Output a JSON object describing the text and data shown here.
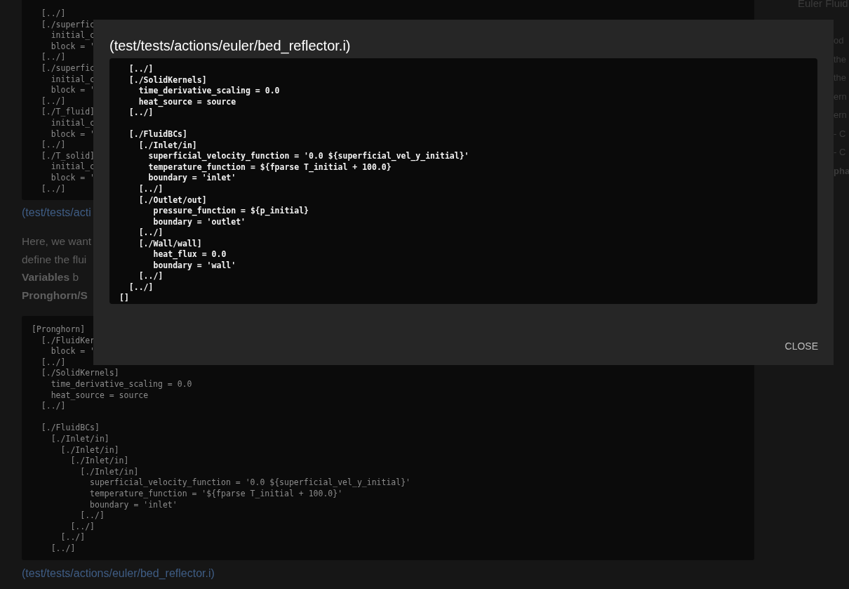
{
  "page": {
    "code_block_1": "  [../]\n  [./superfic\n    initial_c\n    block = '\n  [../]\n  [./superfic\n    initial_c\n    block = '\n  [../]\n  [./T_fluid]\n    initial_c\n    block = '\n  [../]\n  [./T_solid]\n    initial_c\n    block = '\n  [../]",
    "source_link_1": "(test/tests/acti",
    "paragraph": [
      "Here, we want",
      "define the flui",
      "**Variables** b",
      "**Pronghorn/S**"
    ],
    "code_block_2": "[Pronghorn]\n  [./FluidKer\n    block = '\n  [../]\n  [./SolidKernels]\n    time_derivative_scaling = 0.0\n    heat_source = source\n  [../]\n\n  [./FluidBCs]\n    [./Inlet/in]\n      [./Inlet/in]\n        [./Inlet/in]\n          [./Inlet/in]\n            superficial_velocity_function = '0.0 ${superficial_vel_y_initial}'\n            temperature_function = '${fparse T_initial + 100.0}'\n            boundary = 'inlet'\n          [../]\n        [../]\n      [../]\n    [../]",
    "source_link_2": "(test/tests/actions/euler/bed_reflector.i)"
  },
  "sidebar": {
    "lines": [
      "Euler Fluid",
      "od",
      "the",
      "the",
      "ern",
      "ern",
      "- C",
      "- C",
      "pha"
    ]
  },
  "modal": {
    "title": "(test/tests/actions/euler/bed_reflector.i)",
    "code": "  [../]\n  [./SolidKernels]\n    time_derivative_scaling = 0.0\n    heat_source = source\n  [../]\n\n  [./FluidBCs]\n    [./Inlet/in]\n      superficial_velocity_function = '0.0 ${superficial_vel_y_initial}'\n      temperature_function = ${fparse T_initial + 100.0}\n      boundary = 'inlet'\n    [../]\n    [./Outlet/out]\n       pressure_function = ${p_initial}\n       boundary = 'outlet'\n    [../]\n    [./Wall/wall]\n       heat_flux = 0.0\n       boundary = 'wall'\n    [../]\n  [../]\n[]",
    "close_button": "CLOSE"
  }
}
